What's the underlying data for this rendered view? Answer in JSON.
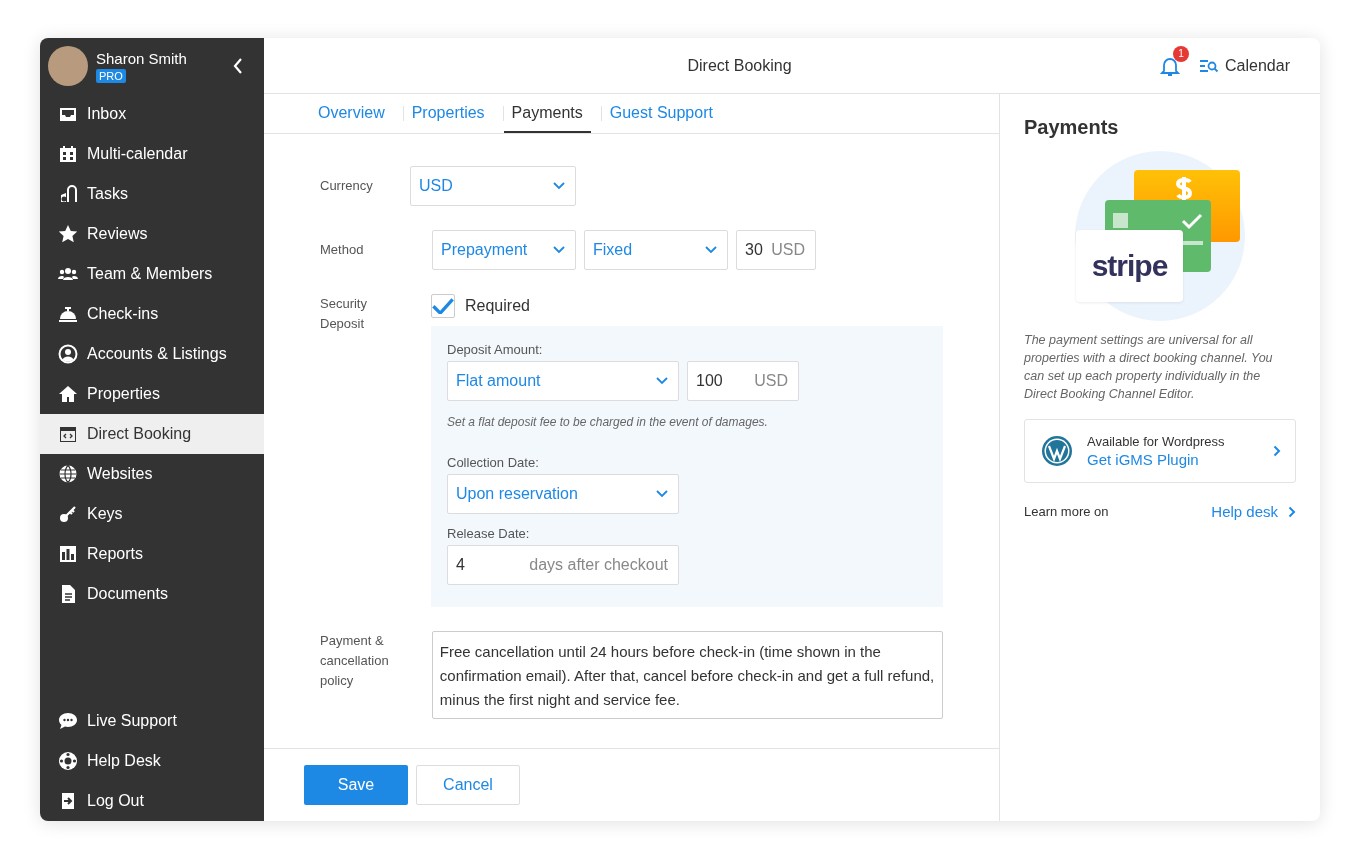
{
  "user": {
    "name": "Sharon Smith",
    "badge": "PRO"
  },
  "sidebar": {
    "items": [
      {
        "label": "Inbox",
        "selected": false
      },
      {
        "label": "Multi-calendar",
        "selected": false
      },
      {
        "label": "Tasks",
        "selected": false
      },
      {
        "label": "Reviews",
        "selected": false
      },
      {
        "label": "Team & Members",
        "selected": false
      },
      {
        "label": "Check-ins",
        "selected": false
      },
      {
        "label": "Accounts & Listings",
        "selected": false
      },
      {
        "label": "Properties",
        "selected": false
      },
      {
        "label": "Direct Booking",
        "selected": true
      },
      {
        "label": "Websites",
        "selected": false
      },
      {
        "label": "Keys",
        "selected": false
      },
      {
        "label": "Reports",
        "selected": false
      },
      {
        "label": "Documents",
        "selected": false
      }
    ],
    "bottom_items": [
      {
        "label": "Live Support"
      },
      {
        "label": "Help Desk"
      },
      {
        "label": "Log Out"
      }
    ]
  },
  "header": {
    "title": "Direct Booking",
    "notifications": "1",
    "calendar_button": "Calendar"
  },
  "tabs": [
    {
      "label": "Overview",
      "selected": false
    },
    {
      "label": "Properties",
      "selected": false
    },
    {
      "label": "Payments",
      "selected": true
    },
    {
      "label": "Guest Support",
      "selected": false
    }
  ],
  "form": {
    "currency": {
      "label": "Currency",
      "value": "USD"
    },
    "method": {
      "label": "Method",
      "type": "Prepayment",
      "mode": "Fixed",
      "amount": "30",
      "unit": "USD"
    },
    "security_deposit": {
      "label": "Security Deposit",
      "checkbox_label": "Required",
      "checked": true,
      "deposit_amount_label": "Deposit Amount:",
      "deposit_type": "Flat amount",
      "amount": "100",
      "unit": "USD",
      "hint": "Set a flat deposit fee to be charged in the event of damages.",
      "collection_date_label": "Collection Date:",
      "collection_date": "Upon reservation",
      "release_date_label": "Release Date:",
      "release_days": "4",
      "release_suffix": "days after checkout"
    },
    "policy": {
      "label": "Payment & cancellation policy",
      "value": "Free cancellation until 24 hours before check-in (time shown in the confirmation email). After that, cancel before check-in and get a full refund, minus the first night and service fee."
    }
  },
  "buttons": {
    "save": "Save",
    "cancel": "Cancel"
  },
  "side_panel": {
    "title": "Payments",
    "logo": "stripe",
    "description": "The payment settings are universal for all properties with a direct booking channel. You can set up each property individually in the Direct Booking Channel Editor.",
    "plugin": {
      "caption": "Available for Wordpress",
      "link": "Get iGMS Plugin"
    },
    "learn_more": "Learn more on",
    "help_link": "Help desk"
  }
}
